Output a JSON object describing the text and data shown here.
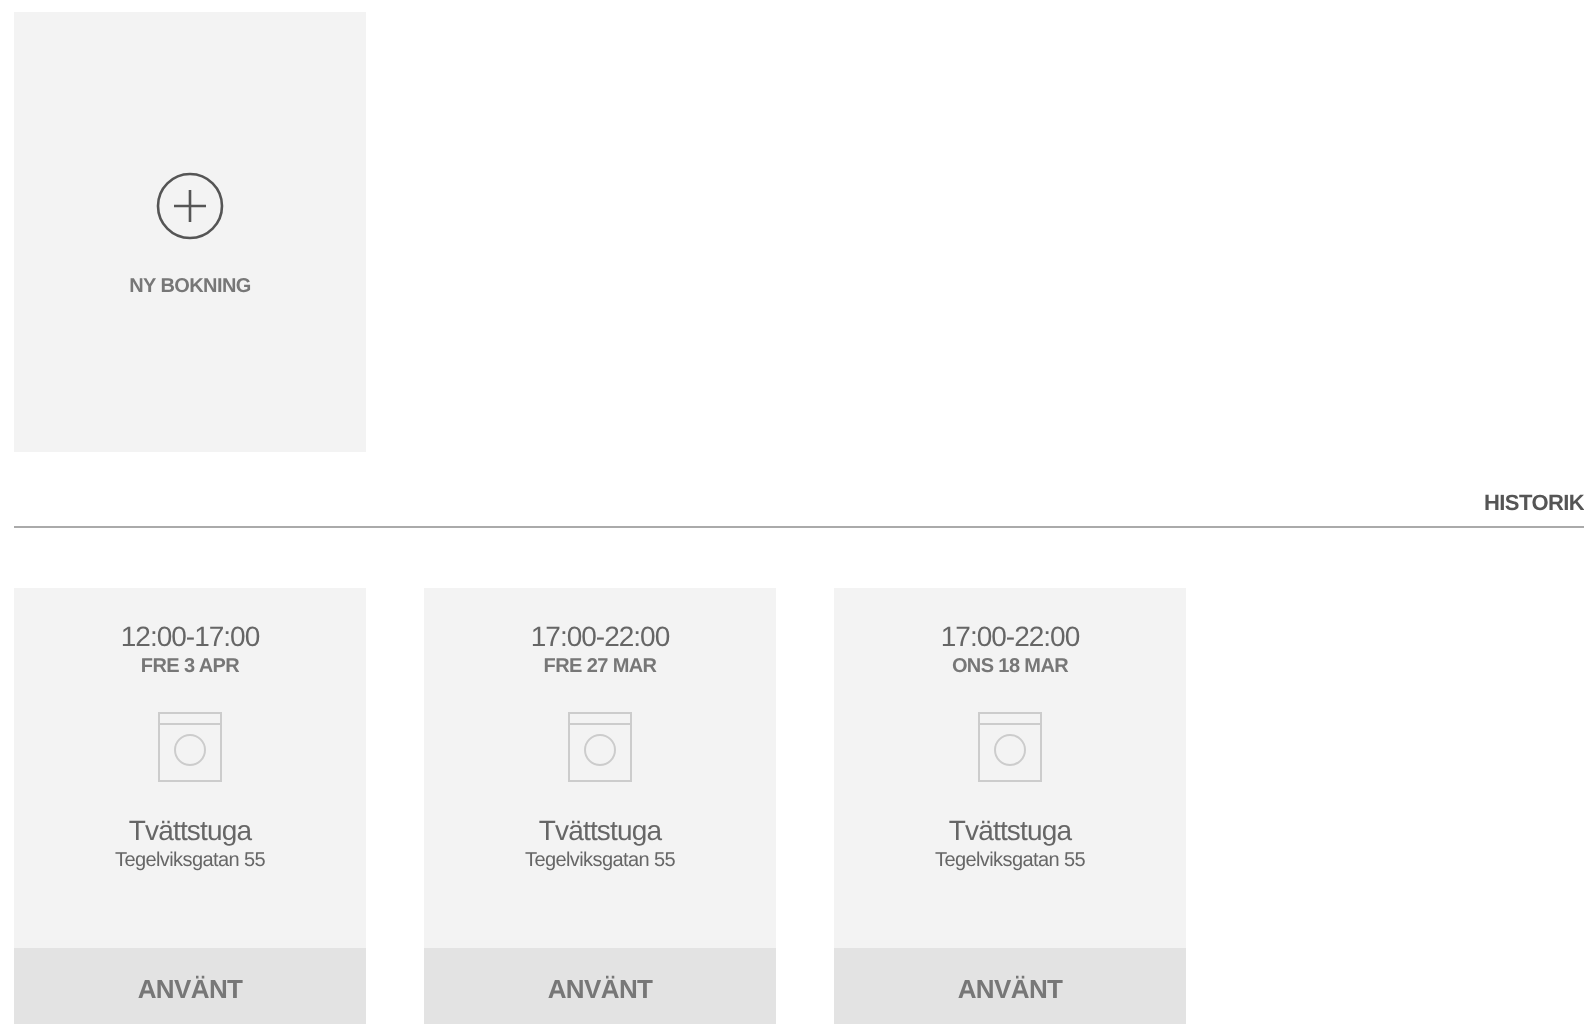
{
  "new_booking": {
    "label": "NY BOKNING"
  },
  "history": {
    "title": "HISTORIK"
  },
  "bookings": [
    {
      "time": "12:00-17:00",
      "date": "FRE 3 APR",
      "place": "Tvättstuga",
      "address": "Tegelviksgatan 55",
      "status": "ANVÄNT"
    },
    {
      "time": "17:00-22:00",
      "date": "FRE 27 MAR",
      "place": "Tvättstuga",
      "address": "Tegelviksgatan 55",
      "status": "ANVÄNT"
    },
    {
      "time": "17:00-22:00",
      "date": "ONS 18 MAR",
      "place": "Tvättstuga",
      "address": "Tegelviksgatan 55",
      "status": "ANVÄNT"
    }
  ]
}
